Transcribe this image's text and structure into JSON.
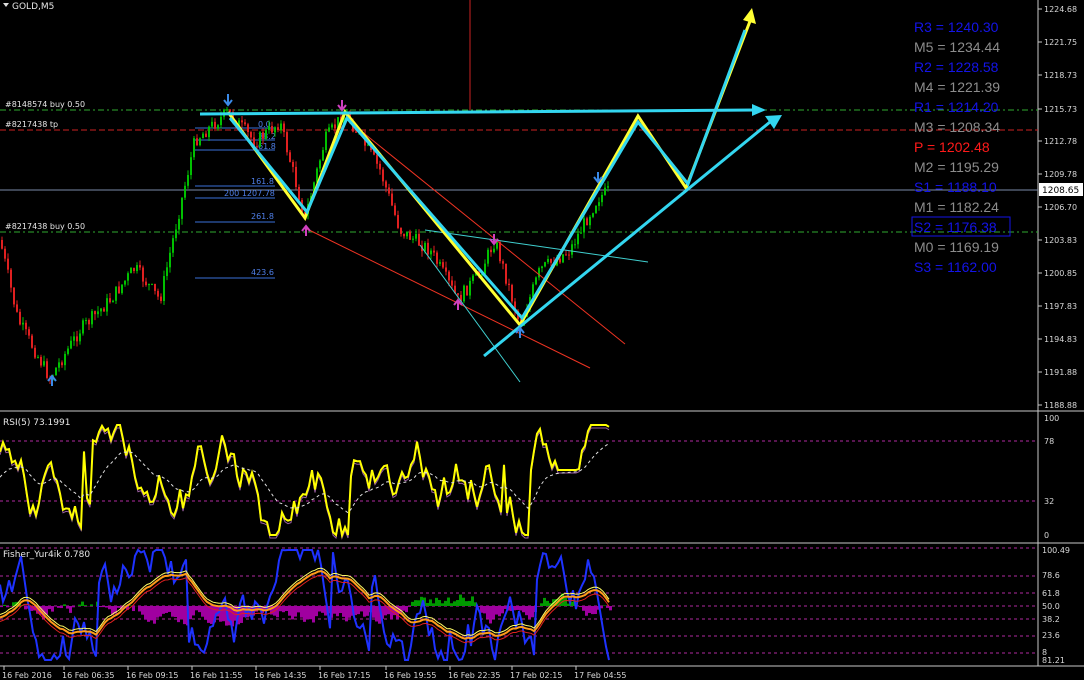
{
  "window": {
    "symbol_title": "GOLD,M5"
  },
  "colors": {
    "background": "#000000",
    "candle_up": "#00c000",
    "candle_down": "#e02020",
    "cyan": "#33d6f0",
    "yellow": "#ffff33",
    "pivot_blue": "#1414e8",
    "pivot_gray": "#8c8c8c",
    "pivot_red": "#ff1a1a",
    "grid_green": "#2faa2f",
    "grid_red": "#cc2222",
    "rsi_line": "#ffff00",
    "fisher_blue": "#1e32ff",
    "fisher_orange": "#ff9b1a",
    "hist_green": "#009900",
    "hist_purple": "#a000a0"
  },
  "main_chart": {
    "price_axis": [
      "1224.68",
      "1221.75",
      "1218.73",
      "1215.73",
      "1212.78",
      "1209.78",
      "1206.70",
      "1203.83",
      "1200.85",
      "1197.83",
      "1194.83",
      "1191.88",
      "1188.88"
    ],
    "current_price": "1208.65",
    "order_labels": [
      "#8148574 buy 0.50",
      "#8217438 tp",
      "#8217438 buy 0.50"
    ],
    "fib_labels": [
      "0.0",
      "38.2",
      "61.8",
      "161.8",
      "200 1207.78",
      "261.8",
      "423.6"
    ],
    "pivots": [
      {
        "label": "R3 = 1240.30",
        "color": "#1414e8"
      },
      {
        "label": "M5 = 1234.44",
        "color": "#8c8c8c"
      },
      {
        "label": "R2 = 1228.58",
        "color": "#1414e8"
      },
      {
        "label": "M4 = 1221.39",
        "color": "#8c8c8c"
      },
      {
        "label": "R1 = 1214.20",
        "color": "#1414e8"
      },
      {
        "label": "M3 = 1208.34",
        "color": "#8c8c8c"
      },
      {
        "label": "P = 1202.48",
        "color": "#ff1a1a"
      },
      {
        "label": "M2 = 1195.29",
        "color": "#8c8c8c"
      },
      {
        "label": "S1 = 1188.10",
        "color": "#1414e8"
      },
      {
        "label": "M1 = 1182.24",
        "color": "#8c8c8c"
      },
      {
        "label": "S2 = 1176.38",
        "color": "#1414e8"
      },
      {
        "label": "M0 = 1169.19",
        "color": "#8c8c8c"
      },
      {
        "label": "S3 = 1162.00",
        "color": "#1414e8"
      }
    ]
  },
  "rsi": {
    "title": "RSI(5) 73.1991",
    "levels": [
      "100",
      "78",
      "32",
      "0"
    ]
  },
  "fisher": {
    "title": "Fisher_Yur4ik 0.780",
    "levels": [
      "100.49",
      "78.6",
      "61.8",
      "50.0",
      "38.2",
      "23.6",
      "8",
      "81.21"
    ]
  },
  "time_axis": [
    "16 Feb 2016",
    "16 Feb 06:35",
    "16 Feb 09:15",
    "16 Feb 11:55",
    "16 Feb 14:35",
    "16 Feb 17:15",
    "16 Feb 19:55",
    "16 Feb 22:35",
    "17 Feb 02:15",
    "17 Feb 04:55"
  ]
}
